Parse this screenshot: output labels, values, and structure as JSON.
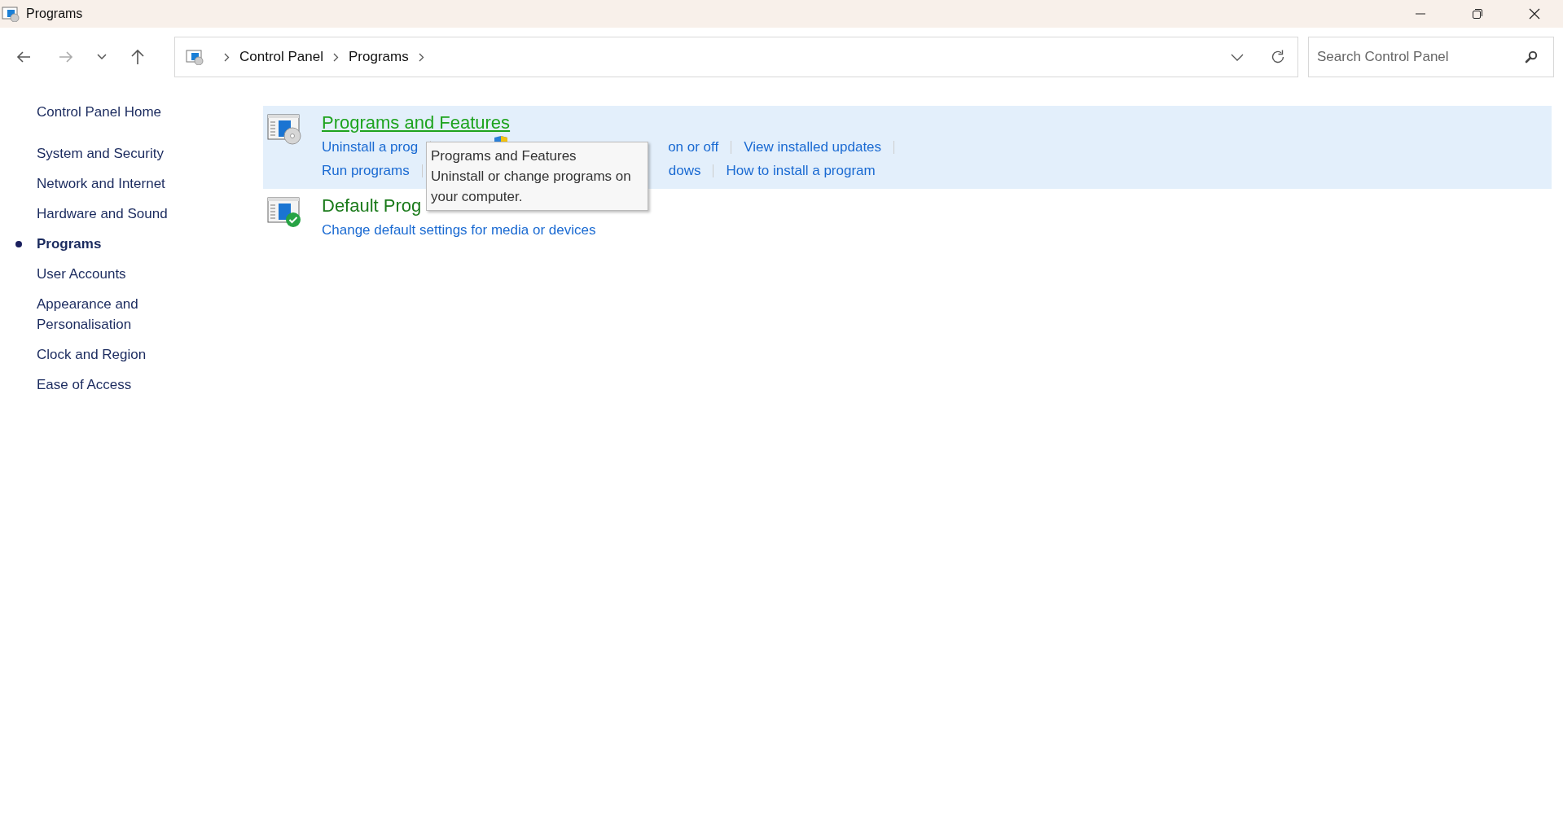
{
  "window": {
    "title": "Programs"
  },
  "address_bar": {
    "breadcrumbs": [
      "Control Panel",
      "Programs"
    ]
  },
  "search": {
    "placeholder": "Search Control Panel"
  },
  "sidebar": {
    "home": "Control Panel Home",
    "items": [
      {
        "label": "System and Security",
        "selected": false
      },
      {
        "label": "Network and Internet",
        "selected": false
      },
      {
        "label": "Hardware and Sound",
        "selected": false
      },
      {
        "label": "Programs",
        "selected": true
      },
      {
        "label": "User Accounts",
        "selected": false
      },
      {
        "label": "Appearance and Personalisation",
        "selected": false
      },
      {
        "label": "Clock and Region",
        "selected": false
      },
      {
        "label": "Ease of Access",
        "selected": false
      }
    ]
  },
  "categories": [
    {
      "title": "Programs and Features",
      "kind": "disc",
      "highlighted": true,
      "link_rows": [
        [
          "Uninstall a prog",
          "on or off",
          "View installed updates"
        ],
        [
          "Run programs",
          "dows",
          "How to install a program"
        ]
      ]
    },
    {
      "title": "Default Prog",
      "kind": "check",
      "highlighted": false,
      "link_rows": [
        [
          "Change default settings for media or devices"
        ]
      ]
    }
  ],
  "tooltip": {
    "title": "Programs and Features",
    "text": "Uninstall or change programs on your computer."
  }
}
